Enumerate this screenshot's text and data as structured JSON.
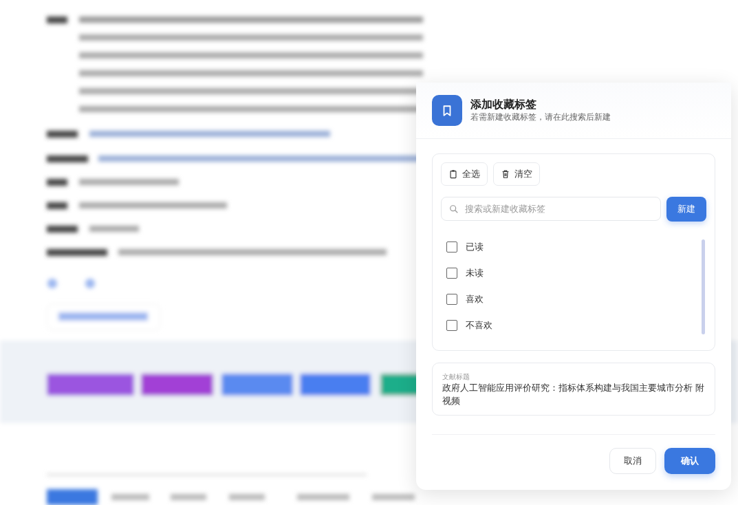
{
  "dialog": {
    "title": "添加收藏标签",
    "subtitle": "若需新建收藏标签，请在此搜索后新建",
    "actions": [
      {
        "kind": "select-all",
        "label": "全选"
      },
      {
        "kind": "clear",
        "label": "清空"
      }
    ],
    "search": {
      "placeholder": "搜索或新建收藏标签"
    },
    "create_button": "新建",
    "tags": [
      {
        "label": "已读",
        "checked": false
      },
      {
        "label": "未读",
        "checked": false
      },
      {
        "label": "喜欢",
        "checked": false
      },
      {
        "label": "不喜欢",
        "checked": false
      }
    ],
    "document": {
      "label": "文献标题",
      "value": "政府人工智能应用评价研究：指标体系构建与我国主要城市分析 附视频"
    },
    "buttons": [
      {
        "kind": "secondary",
        "label": "取消"
      },
      {
        "kind": "primary",
        "label": "确认"
      }
    ]
  }
}
